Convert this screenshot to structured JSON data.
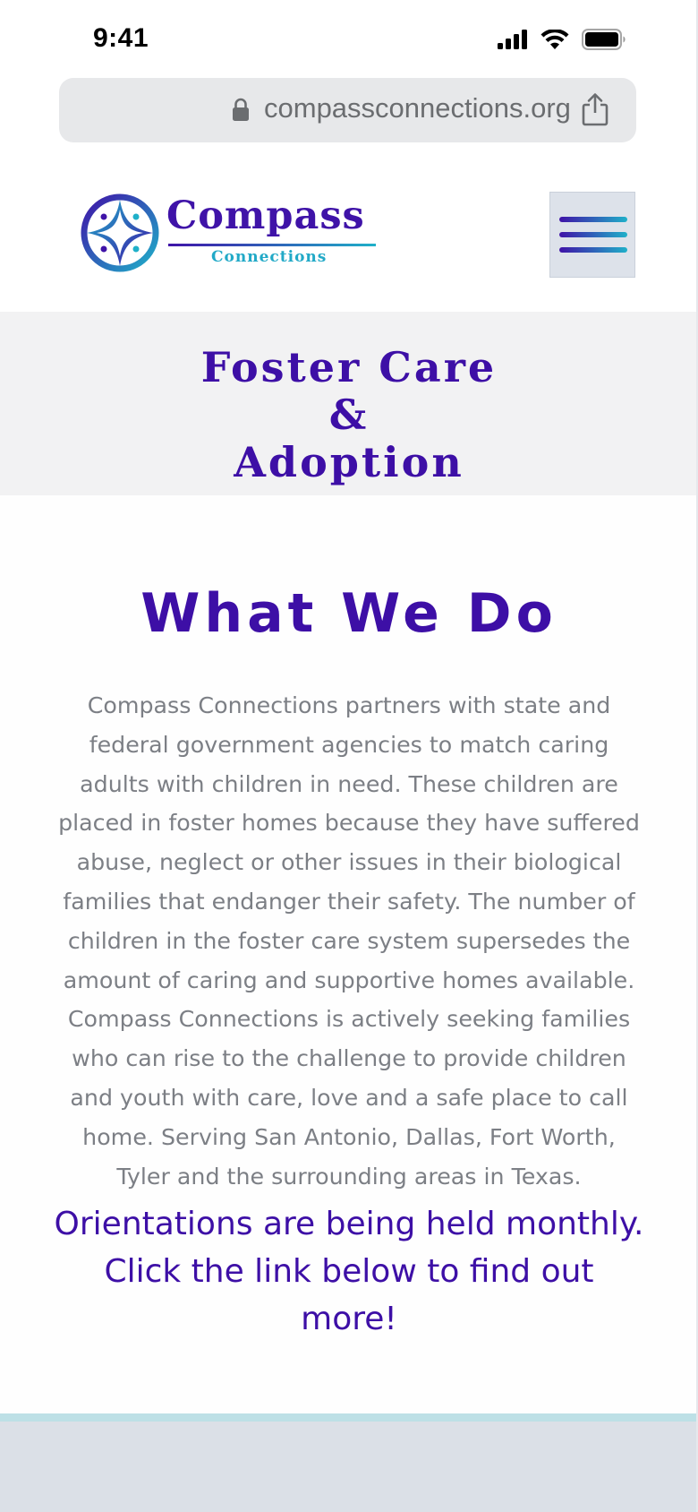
{
  "status_bar": {
    "time": "9:41",
    "icons": [
      "signal-icon",
      "wifi-icon",
      "battery-icon"
    ]
  },
  "browser": {
    "url": "compassconnections.org",
    "icons": [
      "lock-icon",
      "share-icon"
    ]
  },
  "header": {
    "logo_title": "Compass",
    "logo_subtitle": "Connections",
    "menu_icon": "hamburger-menu-icon"
  },
  "hero": {
    "title_lines": [
      "Foster Care",
      "&",
      "Adoption"
    ]
  },
  "main": {
    "section_title": "What We Do",
    "body": "Compass Connections partners with state and federal government agencies to match caring adults with children in need. These children are placed in foster homes because they have suffered abuse, neglect or other issues in their biological families that endanger their safety. The number of children in the foster care system supersedes the amount of caring and supportive homes available. Compass Connections is actively seeking families who can rise to the challenge to provide children and youth with care, love and a safe place to call home. Serving San Antonio, Dallas, Fort Worth, Tyler and the surrounding areas in Texas.",
    "orientation": "Orientations are being held monthly. Click the link below to find out more!"
  },
  "colors": {
    "brand_purple": "#3d0fa6",
    "brand_teal": "#1fb0c9",
    "body_gray": "#7c7f85",
    "hero_background": "#f2f2f3"
  }
}
